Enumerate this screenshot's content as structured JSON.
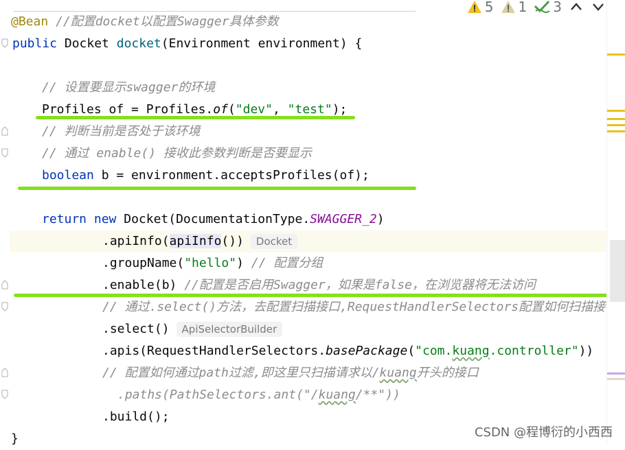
{
  "inspection": {
    "warnings_count": "5",
    "weak_warnings_count": "1",
    "ok_count": "3"
  },
  "code": {
    "l1_annotation": "@Bean",
    "l1_comment": "//配置docket以配置Swagger具体参数",
    "l2_kw": "public",
    "l2_type": " Docket ",
    "l2_method": "docket",
    "l2_rest": "(Environment environment) {",
    "l4_comment": "// 设置要显示swagger的环境",
    "l5_a": "Profiles of = Profiles.",
    "l5_static": "of",
    "l5_b": "(",
    "l5_s1": "\"dev\"",
    "l5_c": ", ",
    "l5_s2": "\"test\"",
    "l5_d": ");",
    "l6_comment": "// 判断当前是否处于该环境",
    "l7_comment": "// 通过 enable() 接收此参数判断是否要显示",
    "l8_kw": "boolean",
    "l8_rest": " b = environment.acceptsProfiles(of);",
    "l10_kw1": "return",
    "l10_kw2": " new",
    "l10_a": " Docket(DocumentationType.",
    "l10_const": "SWAGGER_2",
    "l10_b": ")",
    "l11_a": ".apiInfo(",
    "l11_b": "apiInfo",
    "l11_c": "())",
    "l11_hint": "Docket",
    "l12_a": ".groupName(",
    "l12_str": "\"hello\"",
    "l12_b": ") ",
    "l12_comment": "// 配置分组",
    "l13_a": ".enable(b) ",
    "l13_comment": "//配置是否启用Swagger，如果是false，在浏览器将无法访问",
    "l14_comment": "// 通过.select()方法，去配置扫描接口,RequestHandlerSelectors配置如何扫描接",
    "l15_a": ".select()",
    "l15_hint": "ApiSelectorBuilder",
    "l16_a": ".apis(RequestHandlerSelectors.",
    "l16_static": "basePackage",
    "l16_b": "(",
    "l16_s_pre": "\"com.",
    "l16_s_wavy": "kuang",
    "l16_s_post": ".controller\"",
    "l16_c": "))",
    "l17_c_pre": "// 配置如何通过path过滤,即这里只扫描请求以/",
    "l17_c_wavy": "kuang",
    "l17_c_post": "开头的接口",
    "l18_c_pre": ".paths(PathSelectors.ant(\"/",
    "l18_c_wavy": "kuang",
    "l18_c_post": "/**\"))",
    "l19_a": ".build();",
    "l20_a": "}"
  },
  "watermark": "CSDN @程博衍的小西西",
  "colors": {
    "keyword": "#0033b3",
    "string": "#067d17",
    "comment": "#8c8c8c",
    "annotation": "#9e880d",
    "constant": "#871094",
    "highlight_marker": "#84e01c"
  }
}
